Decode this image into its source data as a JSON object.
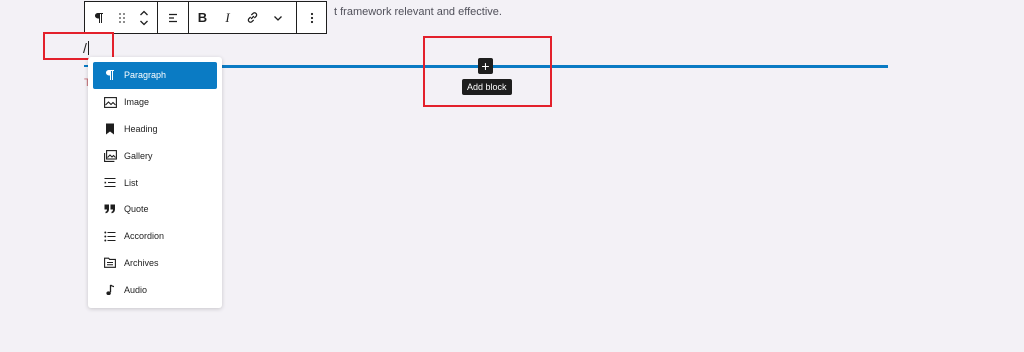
{
  "background_text": "t framework relevant and effective.",
  "toolbar": {
    "paragraph_icon": "pilcrow-icon",
    "drag_icon": "drag-handle-icon",
    "move_icon": "move-up-down-icon",
    "align_icon": "align-left-icon",
    "bold_label": "B",
    "italic_label": "I",
    "link_icon": "link-icon",
    "more_icon": "chevron-down-icon",
    "options_icon": "kebab-menu-icon"
  },
  "editor": {
    "typed_text": "/",
    "mini_mark": "T"
  },
  "add_block": {
    "icon": "plus-icon",
    "label": "+",
    "tooltip": "Add block"
  },
  "inserter": {
    "items": [
      {
        "label": "Paragraph",
        "icon": "paragraph-icon",
        "selected": true
      },
      {
        "label": "Image",
        "icon": "image-icon",
        "selected": false
      },
      {
        "label": "Heading",
        "icon": "heading-icon",
        "selected": false
      },
      {
        "label": "Gallery",
        "icon": "gallery-icon",
        "selected": false
      },
      {
        "label": "List",
        "icon": "list-icon",
        "selected": false
      },
      {
        "label": "Quote",
        "icon": "quote-icon",
        "selected": false
      },
      {
        "label": "Accordion",
        "icon": "accordion-icon",
        "selected": false
      },
      {
        "label": "Archives",
        "icon": "archives-icon",
        "selected": false
      },
      {
        "label": "Audio",
        "icon": "audio-icon",
        "selected": false
      }
    ]
  },
  "colors": {
    "accent": "#0a7bc4",
    "annotation": "#e3202b",
    "dark": "#1e1e1e",
    "background": "#f3f1f6"
  }
}
